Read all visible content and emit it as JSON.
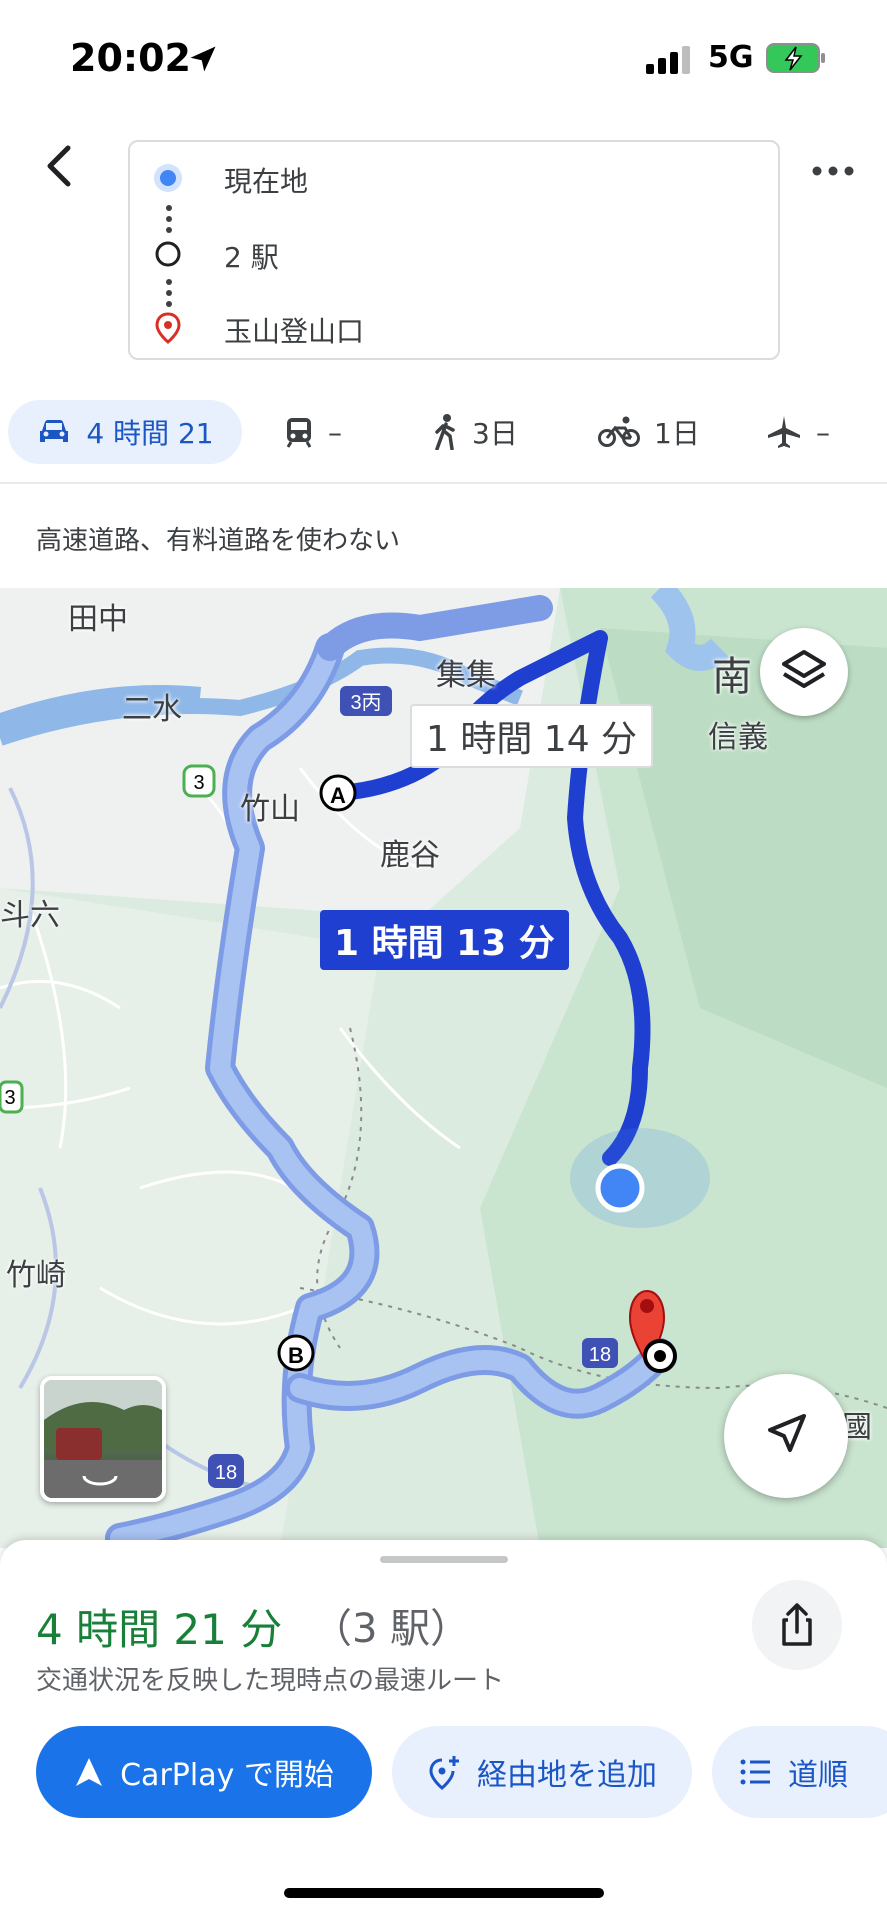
{
  "status_bar": {
    "time": "20:02",
    "network": "5G"
  },
  "route": {
    "origin": "現在地",
    "waypoint": "2 駅",
    "destination": "玉山登山口"
  },
  "modes": [
    {
      "name": "drive",
      "label": "4 時間 21"
    },
    {
      "name": "transit",
      "label": "–"
    },
    {
      "name": "walk",
      "label": "3日"
    },
    {
      "name": "bike",
      "label": "1日"
    },
    {
      "name": "flight",
      "label": "–"
    }
  ],
  "options_text": "高速道路、有料道路を使わない",
  "map": {
    "route_time_main": "1 時間 13 分",
    "route_time_alt": "1 時間 14 分",
    "labels": [
      "田中",
      "二水",
      "集集",
      "南",
      "信義",
      "竹山",
      "鹿谷",
      "斗六",
      "竹崎",
      "國"
    ],
    "road_badges": [
      "3丙",
      "3",
      "18",
      "18",
      "3"
    ],
    "markers": [
      "A",
      "B"
    ]
  },
  "summary": {
    "time": "4 時間 21 分",
    "stops": "（3 駅）",
    "note": "交通状況を反映した現時点の最速ルート"
  },
  "actions": {
    "start": "CarPlay で開始",
    "add_stop": "経由地を追加",
    "steps": "道順"
  },
  "colors": {
    "route_primary": "#1f3fd0",
    "route_secondary": "#8fb0ee",
    "accent": "#1a73e8",
    "summary_green": "#188038",
    "destination_pin": "#d93025"
  }
}
